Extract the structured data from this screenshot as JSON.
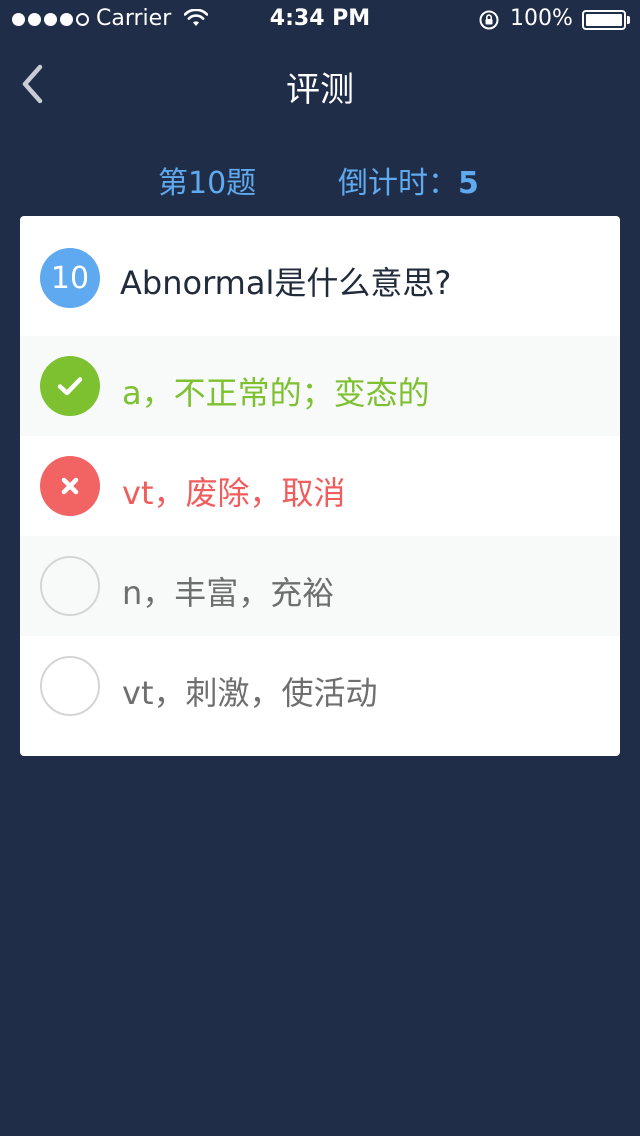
{
  "status_bar": {
    "carrier": "Carrier",
    "time": "4:34 PM",
    "battery": "100%",
    "signal_bars_filled": 4,
    "signal_bars_total": 5
  },
  "nav": {
    "back_icon": "chevron-left-icon",
    "title": "评测"
  },
  "quiz_info": {
    "question_number_label": "第10题",
    "countdown_label": "倒计时：",
    "countdown_value": "5"
  },
  "question": {
    "number": "10",
    "text": "Abnormal是什么意思?"
  },
  "options": [
    {
      "text": "a，不正常的；变态的",
      "state": "correct",
      "icon": "check-icon"
    },
    {
      "text": "vt，废除，取消",
      "state": "wrong",
      "icon": "close-icon"
    },
    {
      "text": "n，丰富，充裕",
      "state": "unselected",
      "icon": "empty-circle-icon"
    },
    {
      "text": "vt，刺激，使活动",
      "state": "unselected",
      "icon": "empty-circle-icon"
    }
  ],
  "colors": {
    "background": "#202d48",
    "accent_blue": "#5ea9f0",
    "correct_green": "#7dc130",
    "wrong_red": "#f26464",
    "neutral_text": "#6f6f6f"
  }
}
